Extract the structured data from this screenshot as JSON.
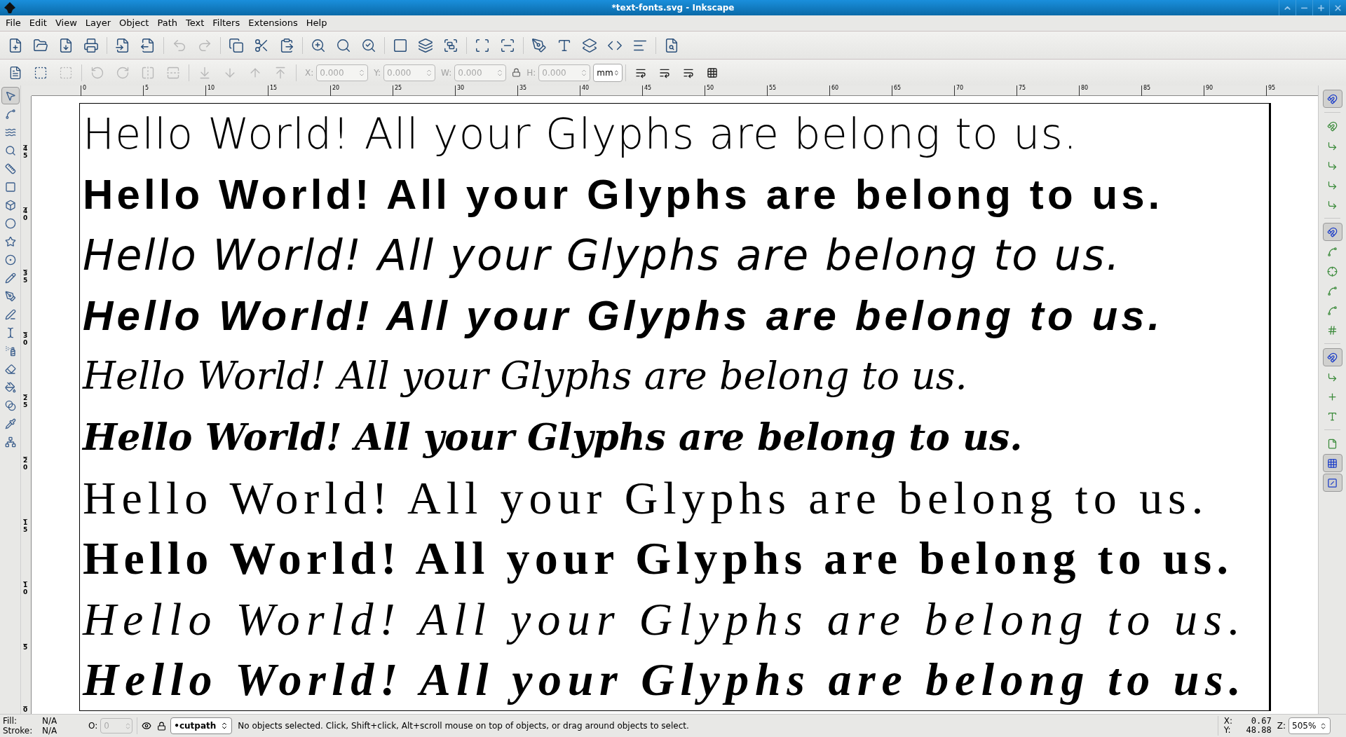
{
  "window": {
    "title": "*text-fonts.svg - Inkscape"
  },
  "menu": [
    "File",
    "Edit",
    "View",
    "Layer",
    "Object",
    "Path",
    "Text",
    "Filters",
    "Extensions",
    "Help"
  ],
  "toolbar": [
    {
      "disabled": false
    },
    {
      "disabled": false
    },
    {
      "disabled": false
    },
    {
      "disabled": false
    },
    {
      "disabled": false
    },
    {
      "disabled": false
    },
    {
      "disabled": true
    },
    {
      "disabled": true
    },
    {
      "disabled": false
    },
    {
      "disabled": false
    },
    {
      "disabled": false
    },
    {
      "disabled": false
    },
    {
      "disabled": false
    },
    {
      "disabled": false
    },
    {
      "disabled": false
    },
    {
      "disabled": false
    },
    {
      "disabled": false
    },
    {
      "disabled": false
    },
    {
      "disabled": false
    },
    {
      "disabled": false
    },
    {
      "disabled": false
    },
    {
      "disabled": false
    },
    {
      "disabled": false
    },
    {
      "disabled": false
    },
    {
      "disabled": false
    }
  ],
  "select_toolbar": {
    "buttons": [
      {
        "disabled": false
      },
      {
        "disabled": false
      },
      {
        "disabled": true
      },
      {
        "disabled": true
      },
      {
        "disabled": true
      },
      {
        "disabled": true
      },
      {
        "disabled": true
      },
      {
        "disabled": true
      },
      {
        "disabled": true
      },
      {
        "disabled": true
      },
      {
        "disabled": true
      }
    ],
    "fields": [
      {
        "label": "X:",
        "value": "0.000"
      },
      {
        "label": "Y:",
        "value": "0.000"
      },
      {
        "label": "W:",
        "value": "0.000"
      },
      {
        "label": "H:",
        "value": "0.000"
      }
    ],
    "unit": "mm"
  },
  "ruler": {
    "horizontal": [
      "0",
      "5",
      "10",
      "15",
      "20",
      "25",
      "30",
      "35",
      "40",
      "45",
      "50",
      "55",
      "60",
      "65",
      "70",
      "75",
      "80",
      "85",
      "90",
      "95"
    ],
    "vertical": [
      "45",
      "40",
      "35",
      "30",
      "25",
      "20",
      "15",
      "10",
      "5",
      "0"
    ]
  },
  "tools": [
    {
      "selected": true
    },
    {
      "selected": false
    },
    {
      "selected": false
    },
    {
      "selected": false
    },
    {
      "selected": false
    },
    {
      "selected": false
    },
    {
      "selected": false
    },
    {
      "selected": false
    },
    {
      "selected": false
    },
    {
      "selected": false
    },
    {
      "selected": false
    },
    {
      "selected": false
    },
    {
      "selected": false
    },
    {
      "selected": false
    },
    {
      "selected": false
    },
    {
      "selected": false
    },
    {
      "selected": false
    },
    {
      "selected": false
    },
    {
      "selected": false
    },
    {
      "selected": false
    }
  ],
  "snap_toggles": [
    {
      "on": true
    },
    {
      "on": false
    },
    {
      "on": false
    },
    {
      "on": false
    },
    {
      "on": false
    },
    {
      "on": false
    },
    {
      "on": true
    },
    {
      "on": false
    },
    {
      "on": false
    },
    {
      "on": false
    },
    {
      "on": false
    },
    {
      "on": false
    },
    {
      "on": true
    },
    {
      "on": false
    },
    {
      "on": false
    },
    {
      "on": false
    },
    {
      "on": false
    },
    {
      "on": true
    },
    {
      "on": true
    }
  ],
  "canvas_lines": [
    {
      "text": "Hello World! All your Glyphs are belong to us.",
      "kind": "sans-light"
    },
    {
      "text": "Hello World! All your Glyphs are belong to us.",
      "kind": "sans-bold"
    },
    {
      "text": "Hello World! All your Glyphs are belong to us.",
      "kind": "sans-italic"
    },
    {
      "text": "Hello World! All your Glyphs are belong to us.",
      "kind": "sans-bold-italic"
    },
    {
      "text": "Hello World! All your Glyphs are belong to us.",
      "kind": "script"
    },
    {
      "text": "Hello World! All your Glyphs are belong to us.",
      "kind": "script-bold"
    },
    {
      "text": "Hello World! All your Glyphs are belong to us.",
      "kind": "serif"
    },
    {
      "text": "Hello World! All your Glyphs are belong to us.",
      "kind": "serif-bold"
    },
    {
      "text": "Hello World! All your Glyphs are belong to us.",
      "kind": "serif-italic"
    },
    {
      "text": "Hello World! All your Glyphs are belong to us.",
      "kind": "serif-bold-italic"
    }
  ],
  "status_bar": {
    "fill_label": "Fill:",
    "fill_value": "N/A",
    "stroke_label": "Stroke:",
    "stroke_value": "N/A",
    "opacity_label": "O:",
    "opacity_value": "0",
    "layer": "•cutpath",
    "message": "No objects selected. Click, Shift+click, Alt+scroll mouse on top of objects, or drag around objects to select.",
    "x_label": "X:",
    "x_value": "0.67",
    "y_label": "Y:",
    "y_value": "48.88",
    "zoom_label": "Z:",
    "zoom_value": "505%"
  }
}
